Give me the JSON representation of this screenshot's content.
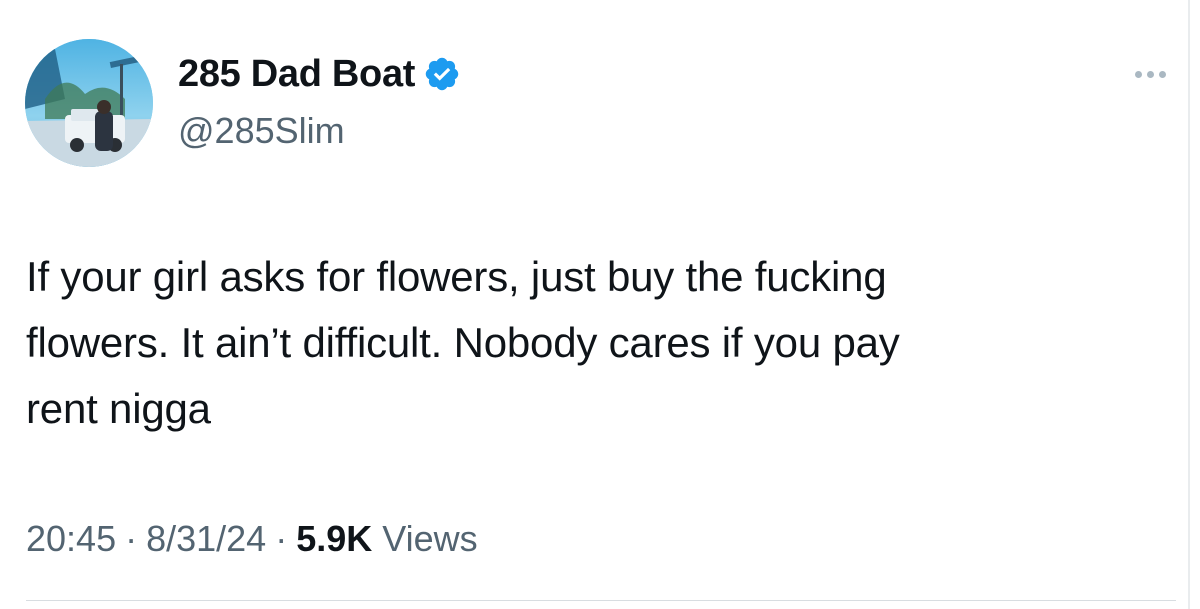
{
  "author": {
    "display_name": "285 Dad Boat",
    "handle": "@285Slim",
    "verified": true,
    "verified_badge_color": "#1d9bf0",
    "avatar_icon": "profile-photo"
  },
  "tweet": {
    "text": "If your girl asks for flowers, just buy the fucking\nflowers. It ain’t difficult. Nobody cares if you pay\nrent nigga"
  },
  "meta": {
    "time": "20:45",
    "separator": "·",
    "date": "8/31/24",
    "views_count": "5.9K",
    "views_label": "Views"
  },
  "actions": {
    "more_icon": "more-options-icon"
  },
  "colors": {
    "primary_text": "#0f1419",
    "secondary_text": "#536471",
    "background": "#ffffff"
  }
}
